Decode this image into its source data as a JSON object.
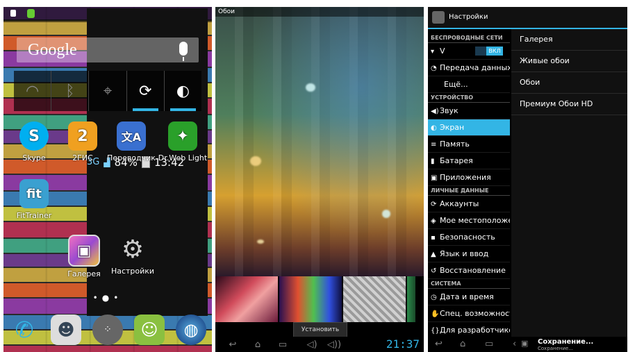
{
  "home": {
    "status": {
      "network": "3G",
      "battery": "84%",
      "time": "13:42"
    },
    "search_logo": "Google",
    "apps": [
      {
        "label": "Skype",
        "glyph": "S",
        "color": "#00aff0"
      },
      {
        "label": "2ГИС",
        "glyph": "2",
        "color": "#f0a020"
      },
      {
        "label": "Переводчик",
        "glyph": "文A",
        "color": "#3a70d0"
      },
      {
        "label": "Dr.Web Light",
        "glyph": "✦",
        "color": "#2aa02a"
      },
      {
        "label": "FitTrainer",
        "glyph": "fit",
        "color": "#3aa0d0"
      },
      {
        "label": "Галерея",
        "glyph": "▣",
        "color": "#9a4ad0"
      },
      {
        "label": "Настройки",
        "glyph": "⚙",
        "color": "#7a7a7a"
      }
    ]
  },
  "wallpaper": {
    "title": "Обои",
    "set_button": "Установить обои",
    "clock": "21:37"
  },
  "settings": {
    "title": "Настройки",
    "sections": [
      {
        "header": "БЕСПРОВОДНЫЕ СЕТИ",
        "items": [
          {
            "label": "V",
            "icon": "wifi-icon",
            "toggle": "ВКЛ"
          },
          {
            "label": "Передача данных",
            "icon": "data-usage-icon"
          },
          {
            "label": "Ещё...",
            "icon": ""
          }
        ]
      },
      {
        "header": "УСТРОЙСТВО",
        "items": [
          {
            "label": "Звук",
            "icon": "sound-icon"
          },
          {
            "label": "Экран",
            "icon": "display-icon",
            "selected": true
          },
          {
            "label": "Память",
            "icon": "storage-icon"
          },
          {
            "label": "Батарея",
            "icon": "battery-icon"
          },
          {
            "label": "Приложения",
            "icon": "apps-icon"
          }
        ]
      },
      {
        "header": "ЛИЧНЫЕ ДАННЫЕ",
        "items": [
          {
            "label": "Аккаунты",
            "icon": "sync-icon"
          },
          {
            "label": "Мое местоположение",
            "icon": "location-icon"
          },
          {
            "label": "Безопасность",
            "icon": "lock-icon"
          },
          {
            "label": "Язык и ввод",
            "icon": "language-icon"
          },
          {
            "label": "Восстановление",
            "icon": "backup-icon"
          }
        ]
      },
      {
        "header": "СИСТЕМА",
        "items": [
          {
            "label": "Дата и время",
            "icon": "clock-icon"
          },
          {
            "label": "Спец. возможности",
            "icon": "accessibility-icon"
          },
          {
            "label": "Для разработчиков",
            "icon": "developer-icon"
          }
        ]
      }
    ],
    "wallpaper_options": [
      "Галерея",
      "Живые обои",
      "Обои",
      "Премиум Обои HD"
    ],
    "toast": {
      "title": "Сохранение...",
      "subtitle": "Сохранение..."
    }
  }
}
